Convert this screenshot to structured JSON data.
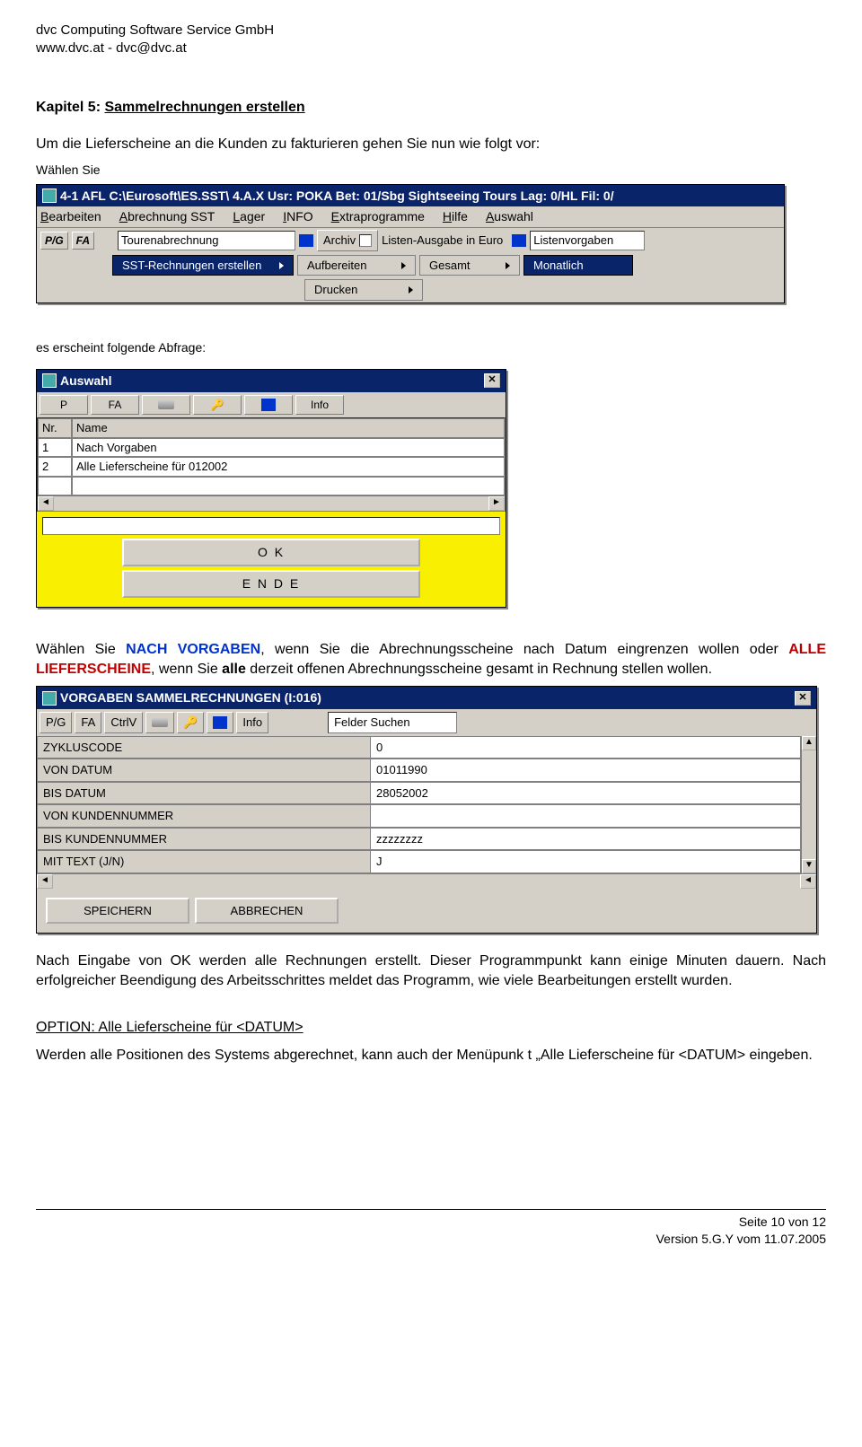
{
  "header": {
    "company": "dvc Computing  Software Service GmbH",
    "contact": "www.dvc.at - dvc@dvc.at"
  },
  "chapter": {
    "label": "Kapitel 5:",
    "title": "Sammelrechnungen erstellen"
  },
  "p1": "Um die Lieferscheine an die Kunden zu fakturieren gehen Sie nun wie folgt vor:",
  "p1b": "Wählen Sie",
  "ss1": {
    "title": "4-1  AFL C:\\Eurosoft\\ES.SST\\ 4.A.X Usr: POKA Bet: 01/Sbg Sightseeing Tours Lag: 0/HL Fil: 0/",
    "menu": [
      "Bearbeiten",
      "Abrechnung SST",
      "Lager",
      "INFO",
      "Extraprogramme",
      "Hilfe",
      "Auswahl"
    ],
    "tb": {
      "pg": "P/G",
      "fa": "FA",
      "tour": "Tourenabrechnung",
      "archiv": "Archiv",
      "listen": "Listen-Ausgabe in Euro",
      "vorgaben": "Listenvorgaben"
    },
    "row3": {
      "sst": "SST-Rechnungen erstellen",
      "auf": "Aufbereiten",
      "gesamt": "Gesamt",
      "monat": "Monatlich"
    },
    "row4": {
      "drucken": "Drucken"
    }
  },
  "p2": "es erscheint folgende Abfrage:",
  "ss2": {
    "title": "Auswahl",
    "tb": {
      "p": "P",
      "fa": "FA",
      "info": "Info"
    },
    "hdr": {
      "nr": "Nr.",
      "name": "Name"
    },
    "rows": [
      {
        "nr": "1",
        "name": "Nach Vorgaben"
      },
      {
        "nr": "2",
        "name": "Alle Lieferscheine für 012002"
      }
    ],
    "ok": "O K",
    "ende": "E N D E"
  },
  "p3a": "Wählen Sie ",
  "p3_nach": "NACH VORGABEN",
  "p3b": ", wenn Sie die Abrechnungsscheine nach Datum eingrenzen wollen oder ",
  "p3_alle": "ALLE LIEFERSCHEINE",
  "p3c": ", wenn Sie ",
  "p3_alle2": "alle",
  "p3d": " derzeit offenen Abrechnungsscheine gesamt in Rechnung stellen wollen.",
  "ss3": {
    "title": "VORGABEN SAMMELRECHNUNGEN (I:016)",
    "tb": {
      "pg": "P/G",
      "fa": "FA",
      "ctrl": "CtrlV",
      "info": "Info",
      "fs": "Felder Suchen"
    },
    "fields": [
      {
        "label": "ZYKLUSCODE",
        "value": "0"
      },
      {
        "label": "VON DATUM",
        "value": "01011990"
      },
      {
        "label": "BIS DATUM",
        "value": "28052002"
      },
      {
        "label": "VON KUNDENNUMMER",
        "value": ""
      },
      {
        "label": "BIS KUNDENNUMMER",
        "value": "zzzzzzzz"
      },
      {
        "label": "MIT TEXT (J/N)",
        "value": "J"
      }
    ],
    "save": "SPEICHERN",
    "cancel": "ABBRECHEN"
  },
  "p4": "Nach Eingabe von OK werden alle Rechnungen erstellt. Dieser Programmpunkt kann einige Minuten dauern. Nach erfolgreicher Beendigung des Arbeitsschrittes meldet das Programm, wie viele Bearbeitungen erstellt wurden.",
  "p5_label": "OPTION: Alle Lieferscheine für <DATUM>",
  "p6": "Werden alle Positionen des Systems abgerechnet, kann auch der Menüpunk t „Alle Lieferscheine für <DATUM> eingeben.",
  "footer": {
    "page": "Seite 10 von 12",
    "version": "Version 5.G.Y vom 11.07.2005"
  }
}
